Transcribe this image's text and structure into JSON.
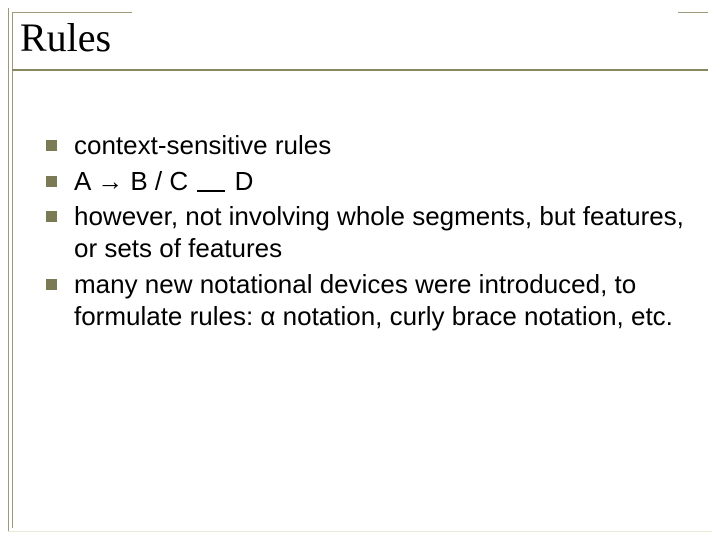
{
  "title": "Rules",
  "bullets": {
    "b0": "context-sensitive rules",
    "b1_prefix": "A → B / C ",
    "b1_suffix": " D",
    "b2": "however, not involving whole segments, but features, or sets of features",
    "b3": "many new notational devices were introduced, to formulate rules: α notation, curly brace notation, etc."
  }
}
